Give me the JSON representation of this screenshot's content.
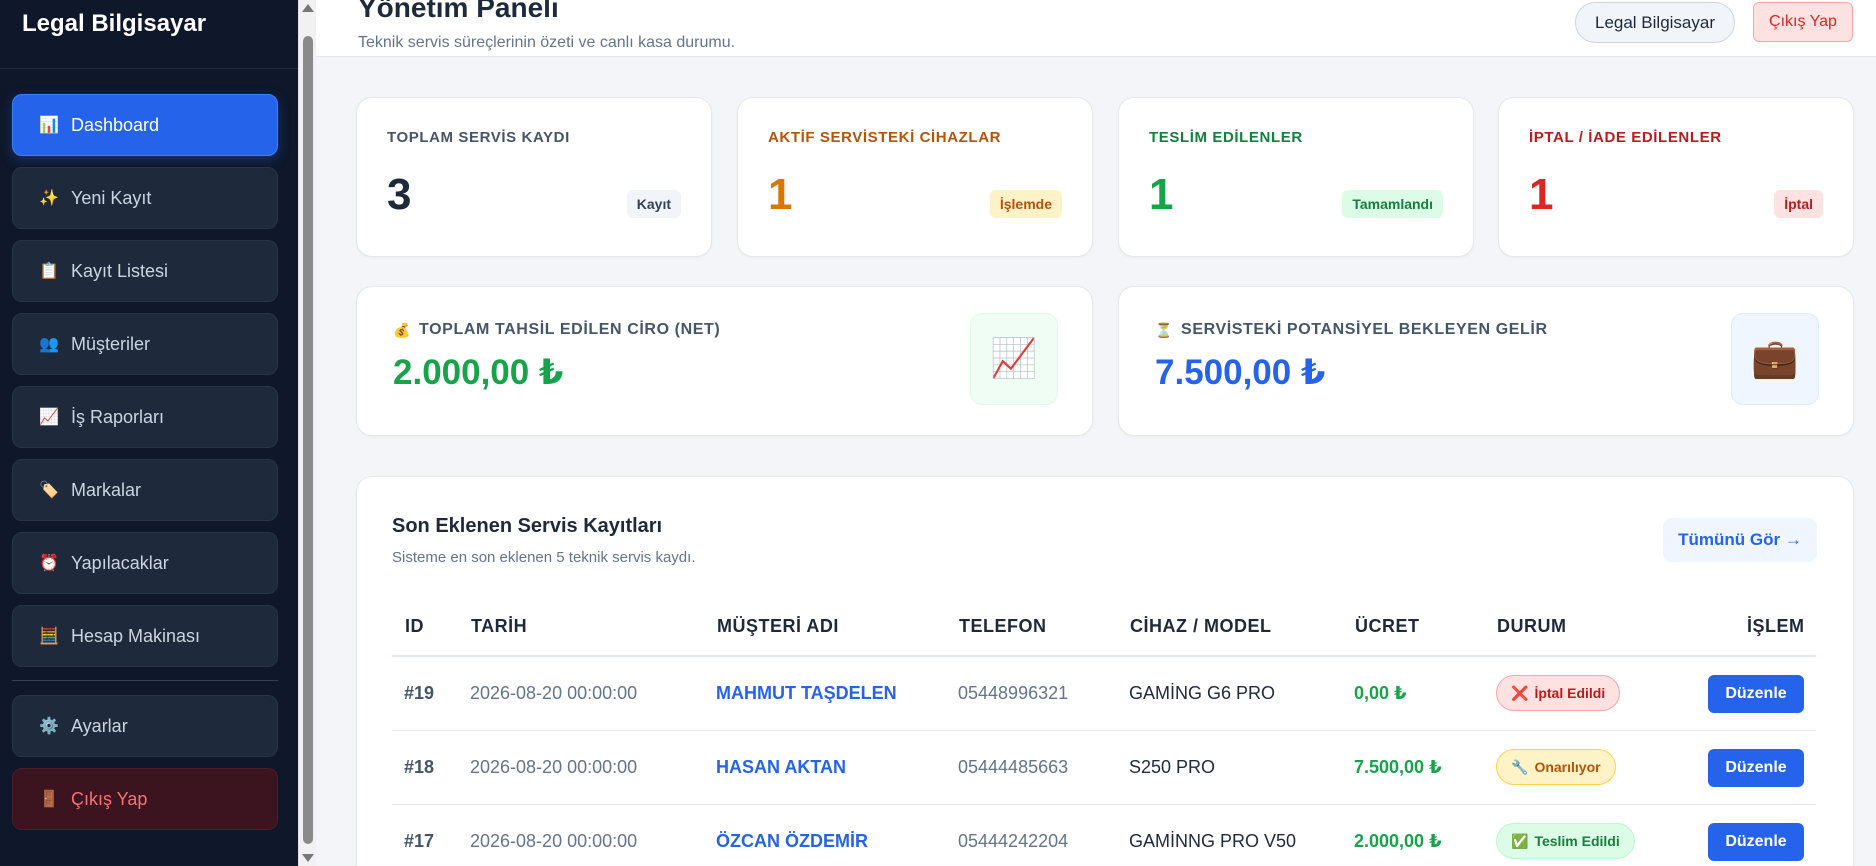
{
  "sidebar": {
    "brand": "Legal Bilgisayar",
    "items": [
      {
        "label": "Dashboard",
        "icon": "📊"
      },
      {
        "label": "Yeni Kayıt",
        "icon": "✨"
      },
      {
        "label": "Kayıt Listesi",
        "icon": "📋"
      },
      {
        "label": "Müşteriler",
        "icon": "👥"
      },
      {
        "label": "İş Raporları",
        "icon": "📈"
      },
      {
        "label": "Markalar",
        "icon": "🏷️"
      },
      {
        "label": "Yapılacaklar",
        "icon": "⏰"
      },
      {
        "label": "Hesap Makinası",
        "icon": "🧮"
      },
      {
        "label": "Ayarlar",
        "icon": "⚙️"
      },
      {
        "label": "Çıkış Yap",
        "icon": "🚪"
      }
    ]
  },
  "header": {
    "title": "Yönetim Paneli",
    "subtitle": "Teknik servis süreçlerinin özeti ve canlı kasa durumu.",
    "user": "Legal Bilgisayar",
    "logout": "Çıkış Yap"
  },
  "stats": [
    {
      "title": "TOPLAM SERVİS KAYDI",
      "value": "3",
      "badge": "Kayıt",
      "color": "#475569",
      "value_color": "#1e293b",
      "badge_bg": "#f1f5f9",
      "badge_fg": "#334155"
    },
    {
      "title": "AKTİF SERVİSTEKİ CİHAZLAR",
      "value": "1",
      "badge": "İşlemde",
      "color": "#b45309",
      "value_color": "#d97706",
      "badge_bg": "#fef3c7",
      "badge_fg": "#b45309"
    },
    {
      "title": "TESLİM EDİLENLER",
      "value": "1",
      "badge": "Tamamlandı",
      "color": "#15803d",
      "value_color": "#16a34a",
      "badge_bg": "#dcfce7",
      "badge_fg": "#15803d"
    },
    {
      "title": "İPTAL / İADE EDİLENLER",
      "value": "1",
      "badge": "İptal",
      "color": "#b91c1c",
      "value_color": "#dc2626",
      "badge_bg": "#fee2e2",
      "badge_fg": "#b91c1c"
    }
  ],
  "money": [
    {
      "title": "TOPLAM TAHSİL EDİLEN CİRO (NET)",
      "value": "2.000,00 ₺",
      "title_icon": "💰",
      "icon": "📈",
      "value_color": "#16a34a",
      "icon_bg": "#f0fdf4"
    },
    {
      "title": "SERVİSTEKİ POTANSİYEL BEKLEYEN GELİR",
      "value": "7.500,00 ₺",
      "title_icon": "⏳",
      "icon": "💼",
      "value_color": "#2563eb",
      "icon_bg": "#eff6ff"
    }
  ],
  "recent": {
    "title": "Son Eklenen Servis Kayıtları",
    "subtitle": "Sisteme en son eklenen 5 teknik servis kaydı.",
    "see_all": "Tümünü Gör →",
    "columns": [
      "ID",
      "TARİH",
      "MÜŞTERİ ADI",
      "TELEFON",
      "CİHAZ / MODEL",
      "ÜCRET",
      "DURUM",
      "İŞLEM"
    ],
    "rows": [
      {
        "id": "#19",
        "date": "2026-08-20 00:00:00",
        "customer": "MAHMUT TAŞDELEN",
        "phone": "05448996321",
        "device": "GAMİNG G6 PRO",
        "price": "0,00 ₺",
        "status": "İptal Edildi",
        "status_icon": "❌",
        "status_bg": "#fee2e2",
        "status_fg": "#b91c1c",
        "status_border": "#fca5a5",
        "action": "Düzenle"
      },
      {
        "id": "#18",
        "date": "2026-08-20 00:00:00",
        "customer": "HASAN AKTAN",
        "phone": "05444485663",
        "device": "S250 PRO",
        "price": "7.500,00 ₺",
        "status": "Onarılıyor",
        "status_icon": "🔧",
        "status_bg": "#fef3c7",
        "status_fg": "#b45309",
        "status_border": "#fcd34d",
        "action": "Düzenle"
      },
      {
        "id": "#17",
        "date": "2026-08-20 00:00:00",
        "customer": "ÖZCAN ÖZDEMİR",
        "phone": "05444242204",
        "device": "GAMİNNG PRO V50",
        "price": "2.000,00 ₺",
        "status": "Teslim Edildi",
        "status_icon": "✅",
        "status_bg": "#dcfce7",
        "status_fg": "#15803d",
        "status_border": "#bbf7d0",
        "action": "Düzenle"
      }
    ]
  }
}
